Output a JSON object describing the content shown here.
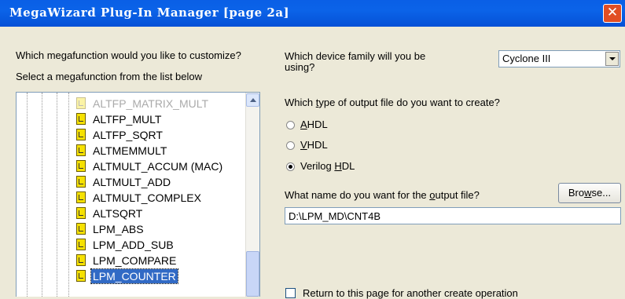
{
  "window": {
    "title": "MegaWizard Plug-In Manager [page 2a]",
    "close_glyph": "✕"
  },
  "left": {
    "question": "Which megafunction would you like to customize?",
    "instruction": "Select a megafunction from the list below",
    "items": [
      {
        "label": "ALTFP_MATRIX_MULT",
        "state": "faded"
      },
      {
        "label": "ALTFP_MULT",
        "state": "normal"
      },
      {
        "label": "ALTFP_SQRT",
        "state": "normal"
      },
      {
        "label": "ALTMEMMULT",
        "state": "normal"
      },
      {
        "label": "ALTMULT_ACCUM (MAC)",
        "state": "normal"
      },
      {
        "label": "ALTMULT_ADD",
        "state": "normal"
      },
      {
        "label": "ALTMULT_COMPLEX",
        "state": "normal"
      },
      {
        "label": "ALTSQRT",
        "state": "normal"
      },
      {
        "label": "LPM_ABS",
        "state": "normal"
      },
      {
        "label": "LPM_ADD_SUB",
        "state": "normal"
      },
      {
        "label": "LPM_COMPARE",
        "state": "normal"
      },
      {
        "label": "LPM_COUNTER",
        "state": "selected"
      }
    ]
  },
  "right": {
    "family_question": "Which device family will you be using?",
    "family_value": "Cyclone III",
    "output_type_question": "Which type of output file do you want to create?",
    "output_type_question_parts": {
      "before": "Which ",
      "key": "t",
      "after": "ype of output file do you want to create?"
    },
    "options": [
      {
        "key": "A",
        "rest": "HDL",
        "selected": false
      },
      {
        "key": "V",
        "rest": "HDL",
        "selected": false
      },
      {
        "pre": "Verilog ",
        "key": "H",
        "rest": "DL",
        "selected": true
      }
    ],
    "output_name_question": {
      "before": "What name do you want for the ",
      "key": "o",
      "after": "utput file?"
    },
    "output_name_value": "D:\\LPM_MD\\CNT4B",
    "browse_button": {
      "pre": "Bro",
      "key": "w",
      "post": "se..."
    },
    "return_checkbox_label": "Return to this page for another create operation",
    "return_checked": false
  },
  "colors": {
    "title_bar": "#0a5fe6",
    "selection": "#316ac5",
    "dialog_bg": "#ece9d8",
    "close": "#e14e24"
  }
}
